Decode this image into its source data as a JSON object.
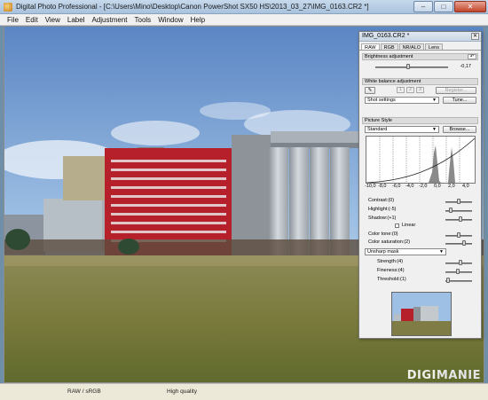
{
  "window": {
    "title": "Digital Photo Professional - [C:\\Users\\Mino\\Desktop\\Canon PowerShot SX50 HS\\2013_03_27\\IMG_0163.CR2 *]",
    "minimize": "–",
    "maximize": "□",
    "close": "✕"
  },
  "menu": [
    "File",
    "Edit",
    "View",
    "Label",
    "Adjustment",
    "Tools",
    "Window",
    "Help"
  ],
  "palette": {
    "title": "IMG_0163.CR2 *",
    "close": "✕",
    "tabs": [
      "RAW",
      "RGB",
      "NR/ALO",
      "Lens"
    ],
    "brightness": {
      "header": "Brightness adjustment",
      "value": "-0,17",
      "level": 0.45
    },
    "white_balance": {
      "header": "White balance adjustment",
      "buttons": [
        "1",
        "2",
        "3"
      ],
      "register": "Register...",
      "preset": "Shot settings",
      "tune": "Tune..."
    },
    "picture_style": {
      "header": "Picture Style",
      "style": "Standard",
      "browse": "Browse...",
      "axis_ticks": [
        "-10,0",
        "-8,0",
        "-6,0",
        "-4,0",
        "-2,0",
        "0,0",
        "2,0",
        "4,0"
      ]
    },
    "params": {
      "contrast": {
        "label": "Contrast:(0)",
        "level": 0.5
      },
      "highlight": {
        "label": "Highlight:(-5)",
        "level": 0.2
      },
      "shadow": {
        "label": "Shadow:(+1)",
        "level": 0.55
      },
      "linear": "Linear",
      "color_tone": {
        "label": "Color tone:(0)",
        "level": 0.5
      },
      "color_saturation": {
        "label": "Color saturation:(2)",
        "level": 0.7
      },
      "sharpen_mode": "Unsharp mask",
      "strength": {
        "label": "Strength:(4)",
        "level": 0.55
      },
      "fineness": {
        "label": "Fineness:(4)",
        "level": 0.45
      },
      "threshold": {
        "label": "Threshold:(1)",
        "level": 0.1
      }
    }
  },
  "status": {
    "color": "RAW / sRGB",
    "quality": "High quality"
  },
  "watermark": {
    "part1": "DIGI",
    "part2": "MANIE"
  }
}
